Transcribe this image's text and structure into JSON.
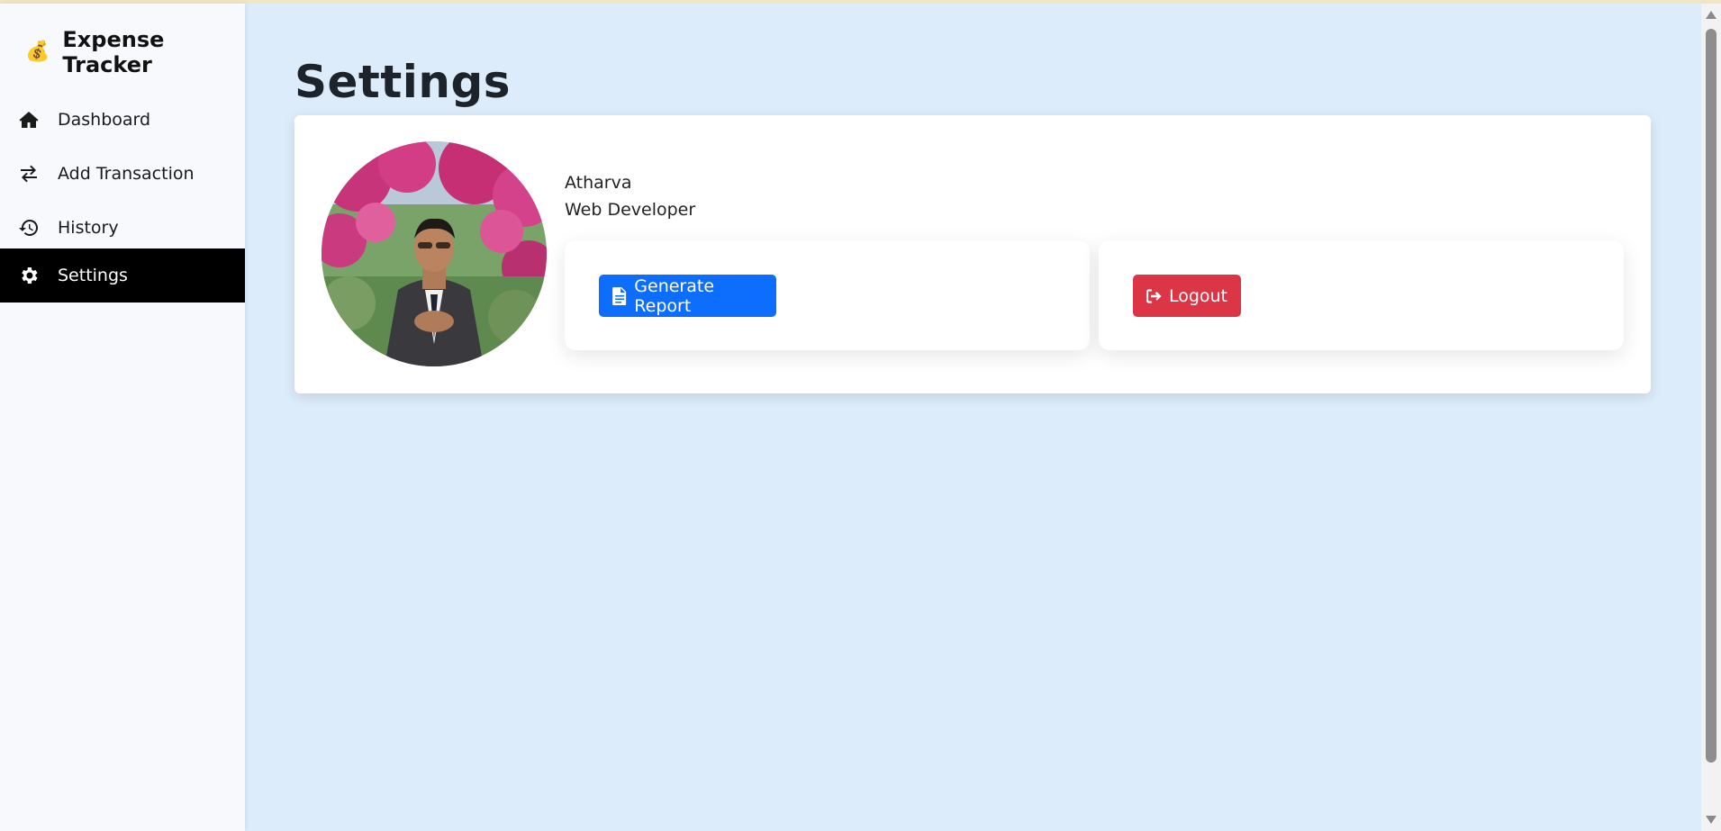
{
  "brand": {
    "icon": "money-bag-icon",
    "emoji": "💰",
    "title": "Expense Tracker"
  },
  "sidebar": {
    "items": [
      {
        "label": "Dashboard",
        "icon": "home-icon",
        "active": false
      },
      {
        "label": "Add Transaction",
        "icon": "exchange-arrows-icon",
        "active": false
      },
      {
        "label": "History",
        "icon": "history-icon",
        "active": false
      },
      {
        "label": "Settings",
        "icon": "gear-icon",
        "active": true
      }
    ]
  },
  "main": {
    "title": "Settings",
    "profile": {
      "name": "Atharva",
      "role": "Web Developer",
      "avatar": "profile-photo"
    },
    "actions": {
      "report_label": "Generate Report",
      "report_icon": "file-icon",
      "logout_label": "Logout",
      "logout_icon": "sign-out-icon"
    }
  },
  "colors": {
    "page_background": "#ddecfb",
    "sidebar_background": "#f7f9fc",
    "active_item": "#000000",
    "primary": "#0d6efd",
    "danger": "#dc3545"
  }
}
